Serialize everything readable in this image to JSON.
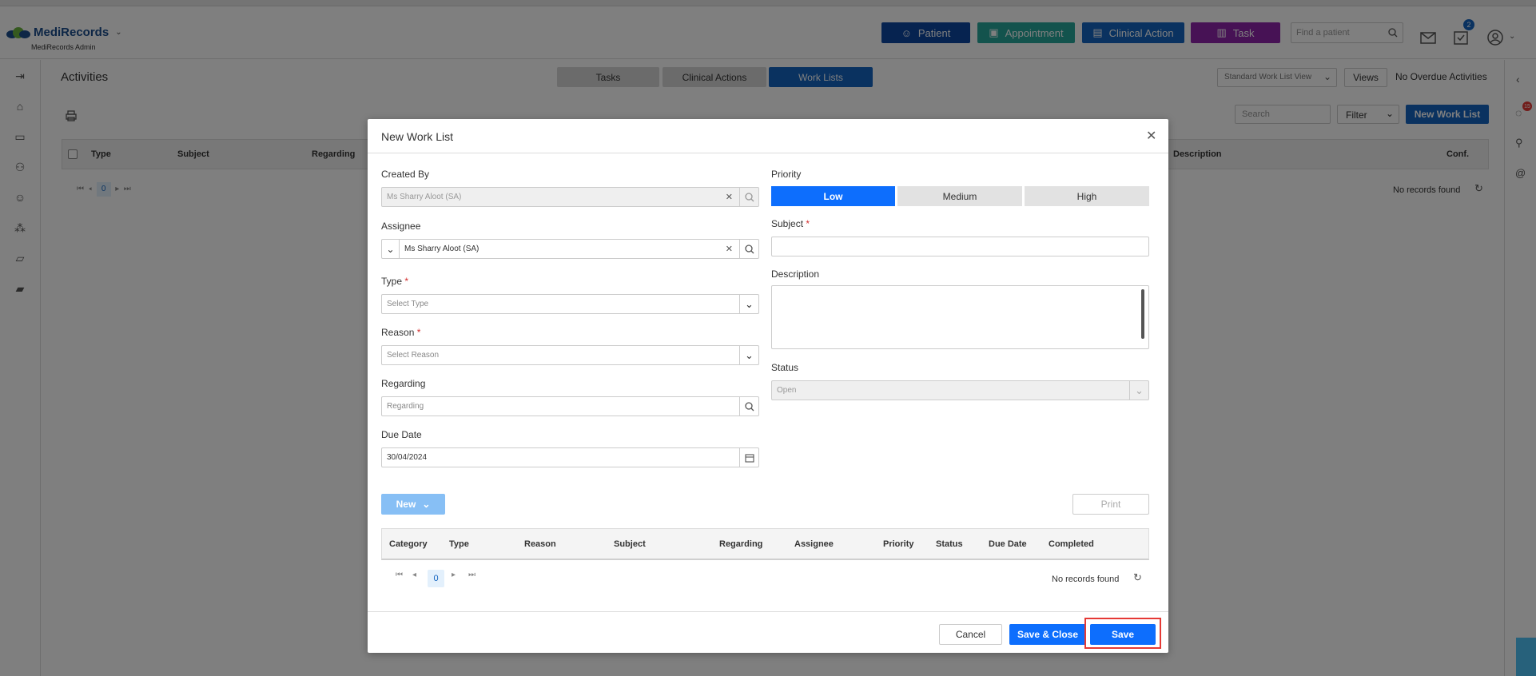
{
  "header": {
    "logo_text": "MediRecords",
    "logo_sub": "MediRecords Admin",
    "buttons": {
      "patient": "Patient",
      "appointment": "Appointment",
      "clinical_action": "Clinical Action",
      "task": "Task"
    },
    "search_placeholder": "Find a patient",
    "task_badge": "2",
    "colors": {
      "patient": "#0d47a1",
      "appointment": "#26a69a",
      "clinical_action": "#1565c0",
      "task": "#8e24aa"
    }
  },
  "page": {
    "title": "Activities",
    "tabs": [
      "Tasks",
      "Clinical Actions",
      "Work Lists"
    ],
    "active_tab": "Work Lists",
    "view_select": "Standard Work List View",
    "views_label": "Views",
    "overdue": "No Overdue Activities",
    "search_placeholder": "Search",
    "filter_label": "Filter",
    "new_work_list_label": "New Work List",
    "grid_headers": [
      "Type",
      "Subject",
      "Regarding",
      "Description",
      "Conf."
    ],
    "pager_current": "0",
    "no_records": "No records found",
    "notif_badge": "15"
  },
  "modal": {
    "title": "New Work List",
    "created_by_label": "Created By",
    "created_by_value": "Ms Sharry Aloot (SA)",
    "assignee_label": "Assignee",
    "assignee_value": "Ms Sharry Aloot (SA)",
    "type_label": "Type",
    "type_placeholder": "Select Type",
    "reason_label": "Reason",
    "reason_placeholder": "Select Reason",
    "regarding_label": "Regarding",
    "regarding_placeholder": "Regarding",
    "due_date_label": "Due Date",
    "due_date_value": "30/04/2024",
    "priority_label": "Priority",
    "priority_options": [
      "Low",
      "Medium",
      "High"
    ],
    "priority_selected": "Low",
    "subject_label": "Subject",
    "description_label": "Description",
    "status_label": "Status",
    "status_value": "Open",
    "new_label": "New",
    "print_label": "Print",
    "grid_headers": [
      "Category",
      "Type",
      "Reason",
      "Subject",
      "Regarding",
      "Assignee",
      "Priority",
      "Status",
      "Due Date",
      "Completed"
    ],
    "pager_current": "0",
    "no_records": "No records found",
    "cancel_label": "Cancel",
    "save_close_label": "Save & Close",
    "save_label": "Save",
    "accent": "#0d6efd",
    "highlight": "#e53935"
  }
}
